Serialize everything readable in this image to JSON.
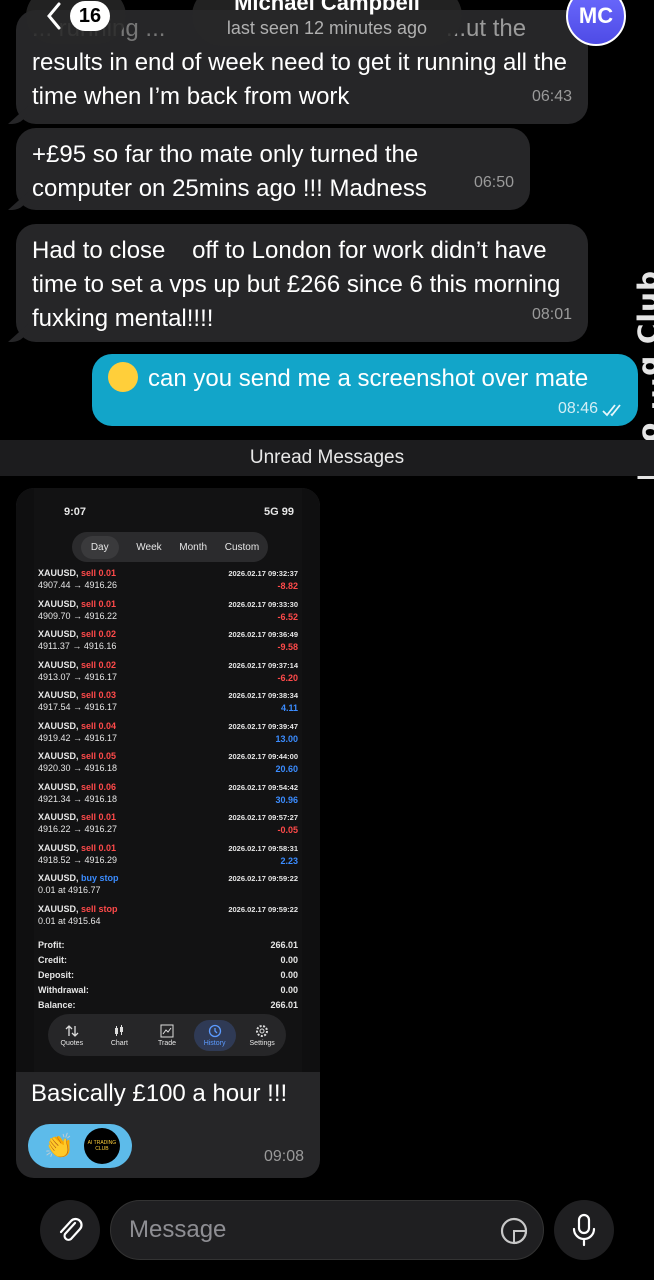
{
  "header": {
    "back_count": "16",
    "name": "Michael Campbell",
    "status": "last seen 12 minutes ago",
    "avatar_initials": "MC"
  },
  "wallpaper_text": "Luo ...g Club",
  "messages": [
    {
      "line1_faded": "... running ...",
      "line1_end": "...ut the",
      "text": "results in end of week need to get it running all the time when I’m back from work",
      "time": "06:43"
    },
    {
      "text": "+£95 so far tho mate only turned the computer on 25mins ago !!! Madness",
      "time": "06:50"
    },
    {
      "text": "Had to close    off to London for work didn’t have time to set a vps up but £266 since 6 this morning fuxking mental!!!!",
      "time": "08:01"
    }
  ],
  "outgoing": {
    "text": "can you send me a screenshot over mate",
    "time": "08:46",
    "emoji": "exploding-head"
  },
  "unread_label": "Unread Messages",
  "screenshot": {
    "clock": "9:07",
    "network": "5G 99",
    "segments": [
      "Day",
      "Week",
      "Month",
      "Custom"
    ],
    "active_segment": "Day",
    "trades": [
      {
        "sym": "XAUUSD,",
        "side": "sell 0.01",
        "route": "4907.44 → 4916.26",
        "date": "2026.02.17 09:32:37",
        "profit": "-8.82",
        "pcolor": "red"
      },
      {
        "sym": "XAUUSD,",
        "side": "sell 0.01",
        "route": "4909.70 → 4916.22",
        "date": "2026.02.17 09:33:30",
        "profit": "-6.52",
        "pcolor": "red"
      },
      {
        "sym": "XAUUSD,",
        "side": "sell 0.02",
        "route": "4911.37 → 4916.16",
        "date": "2026.02.17 09:36:49",
        "profit": "-9.58",
        "pcolor": "red"
      },
      {
        "sym": "XAUUSD,",
        "side": "sell 0.02",
        "route": "4913.07 → 4916.17",
        "date": "2026.02.17 09:37:14",
        "profit": "-6.20",
        "pcolor": "red"
      },
      {
        "sym": "XAUUSD,",
        "side": "sell 0.03",
        "route": "4917.54 → 4916.17",
        "date": "2026.02.17 09:38:34",
        "profit": "4.11",
        "pcolor": "blue"
      },
      {
        "sym": "XAUUSD,",
        "side": "sell 0.04",
        "route": "4919.42 → 4916.17",
        "date": "2026.02.17 09:39:47",
        "profit": "13.00",
        "pcolor": "blue"
      },
      {
        "sym": "XAUUSD,",
        "side": "sell 0.05",
        "route": "4920.30 → 4916.18",
        "date": "2026.02.17 09:44:00",
        "profit": "20.60",
        "pcolor": "blue"
      },
      {
        "sym": "XAUUSD,",
        "side": "sell 0.06",
        "route": "4921.34 → 4916.18",
        "date": "2026.02.17 09:54:42",
        "profit": "30.96",
        "pcolor": "blue"
      },
      {
        "sym": "XAUUSD,",
        "side": "sell 0.01",
        "route": "4916.22 → 4916.27",
        "date": "2026.02.17 09:57:27",
        "profit": "-0.05",
        "pcolor": "red"
      },
      {
        "sym": "XAUUSD,",
        "side": "sell 0.01",
        "route": "4918.52 → 4916.29",
        "date": "2026.02.17 09:58:31",
        "profit": "2.23",
        "pcolor": "blue"
      },
      {
        "sym": "XAUUSD,",
        "side": "buy stop",
        "route": "0.01 at 4916.77",
        "date": "2026.02.17 09:59:22",
        "profit": "",
        "pcolor": "blue",
        "sidecolor": "blue"
      },
      {
        "sym": "XAUUSD,",
        "side": "sell stop",
        "route": "0.01 at 4915.64",
        "date": "2026.02.17 09:59:22",
        "profit": "",
        "pcolor": "red"
      }
    ],
    "summary": [
      {
        "label": "Profit:",
        "value": "266.01"
      },
      {
        "label": "Credit:",
        "value": "0.00"
      },
      {
        "label": "Deposit:",
        "value": "0.00"
      },
      {
        "label": "Withdrawal:",
        "value": "0.00"
      },
      {
        "label": "Balance:",
        "value": "266.01"
      }
    ],
    "tabs": [
      "Quotes",
      "Chart",
      "Trade",
      "History",
      "Settings"
    ],
    "active_tab": "History"
  },
  "photo_message": {
    "caption": "Basically £100 a hour !!!",
    "time": "09:08",
    "reaction_logo_text": "AI TRADING CLUB"
  },
  "composer": {
    "placeholder": "Message"
  }
}
